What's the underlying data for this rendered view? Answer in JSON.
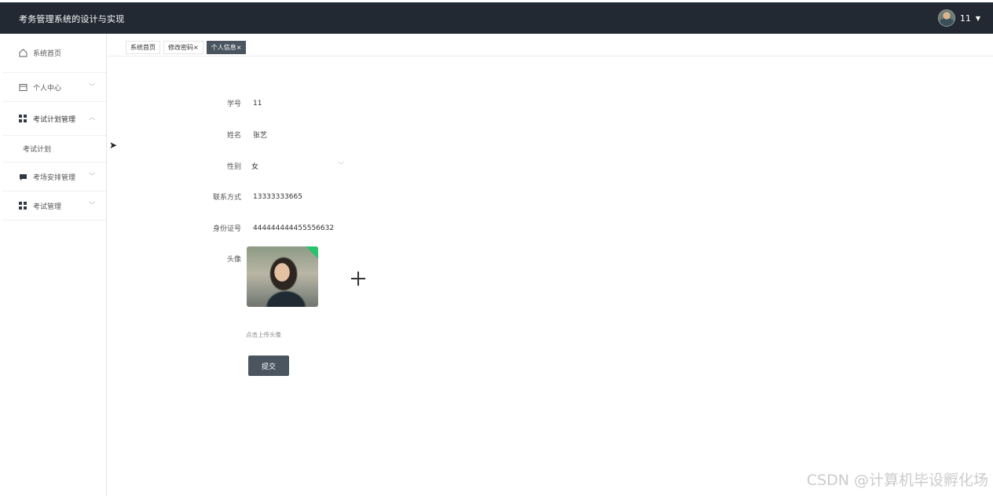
{
  "app": {
    "title": "考务管理系统的设计与实现"
  },
  "user": {
    "name": "11"
  },
  "sidebar": {
    "items": [
      {
        "label": "系统首页",
        "icon": "home-icon"
      },
      {
        "label": "个人中心",
        "icon": "calendar-icon"
      },
      {
        "label": "考试计划管理",
        "icon": "grid-icon",
        "sub": "考试计划"
      },
      {
        "label": "考场安排管理",
        "icon": "chat-icon"
      },
      {
        "label": "考试管理",
        "icon": "grid-icon"
      }
    ]
  },
  "tabs": [
    {
      "label": "系统首页",
      "closable": false
    },
    {
      "label": "修改密码",
      "closable": true
    },
    {
      "label": "个人信息",
      "closable": true,
      "active": true
    }
  ],
  "form": {
    "student_id": {
      "label": "学号",
      "value": "11"
    },
    "name": {
      "label": "姓名",
      "value": "张艺"
    },
    "gender": {
      "label": "性别",
      "value": "女"
    },
    "phone": {
      "label": "联系方式",
      "value": "13333333665"
    },
    "id_card": {
      "label": "身份证号",
      "value": "444444444455556632"
    },
    "avatar": {
      "label": "头像",
      "hint": "点击上传头像"
    },
    "submit_label": "提交"
  },
  "watermark": "CSDN @计算机毕设孵化场",
  "colors": {
    "header_bg": "#222933",
    "active_tab": "#4a5560",
    "button": "#4a5560"
  }
}
